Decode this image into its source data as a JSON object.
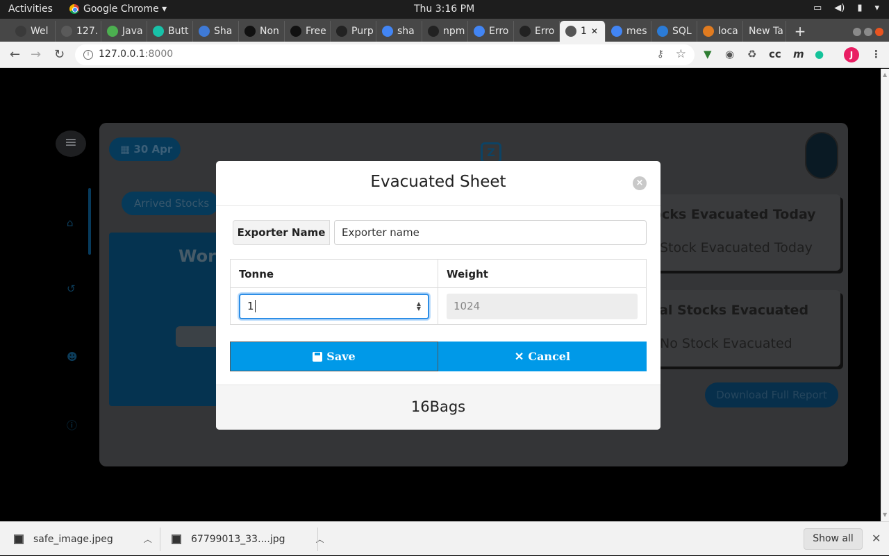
{
  "topbar": {
    "activities": "Activities",
    "app_name": "Google Chrome ▾",
    "clock": "Thu  3:16 PM"
  },
  "tabs": [
    {
      "label": "Wel",
      "color": "#3a3a3a"
    },
    {
      "label": "127.",
      "color": "#5a5a5a"
    },
    {
      "label": "Java",
      "color": "#4caf50"
    },
    {
      "label": "Butt",
      "color": "#18c1a8"
    },
    {
      "label": "Sha",
      "color": "#3f7ad6"
    },
    {
      "label": "Non",
      "color": "#111111"
    },
    {
      "label": "Free",
      "color": "#111111"
    },
    {
      "label": "Purp",
      "color": "#222222"
    },
    {
      "label": "sha",
      "color": "#4285f4"
    },
    {
      "label": "npm",
      "color": "#222222"
    },
    {
      "label": "Erro",
      "color": "#4285f4"
    },
    {
      "label": "Erro",
      "color": "#222222"
    },
    {
      "label": "1",
      "color": "#555555"
    },
    {
      "label": "mes",
      "color": "#4285f4"
    },
    {
      "label": "SQL",
      "color": "#2b7bd6"
    },
    {
      "label": "loca",
      "color": "#e07b20"
    },
    {
      "label": "New Ta",
      "color": "transparent"
    }
  ],
  "address": {
    "host": "127.0.0.1",
    "port": ":8000"
  },
  "background": {
    "date": "30 Apr",
    "tab_label": "Arrived Stocks",
    "work_label": "Work",
    "card1_title": "ocks Evacuated Today",
    "card1_sub": "Stock Evacuated Today",
    "card2_title": "tal Stocks Evacuated",
    "card2_sub": "No Stock Evacuated",
    "download_button": "Download Full Report"
  },
  "modal": {
    "title": "Evacuated Sheet",
    "exporter_label": "Exporter Name",
    "exporter_placeholder": "Exporter name",
    "col_tonne": "Tonne",
    "col_weight": "Weight",
    "tonne_value": "1",
    "weight_value": "1024",
    "save_label": "Save",
    "cancel_label": "Cancel",
    "footer": "16Bags",
    "accent": "#0099e8"
  },
  "shelf": {
    "file1": "safe_image.jpeg",
    "file2": "67799013_33....jpg",
    "show_all": "Show all"
  }
}
